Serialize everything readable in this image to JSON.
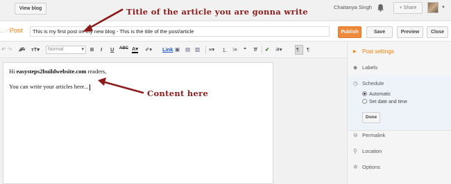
{
  "topbar": {
    "view_blog": "View blog",
    "user_name": "Chaitanya Singh",
    "share": "+ Share"
  },
  "annotations": {
    "title_note": "Title of the article you are gonna write",
    "content_note": "Content here"
  },
  "post": {
    "label": "Post",
    "title_value": "This is my first post on my new blog - This is the title of the post/article",
    "buttons": {
      "publish": "Publish",
      "save": "Save",
      "preview": "Preview",
      "close": "Close"
    }
  },
  "toolbar": {
    "font_size_value": "Normal",
    "link": "Link"
  },
  "editor": {
    "line1_prefix": "Hi ",
    "line1_bold": "easysteps2buildwebsite.com",
    "line1_suffix": " readers,",
    "line2": "You can write your articles here..."
  },
  "sidebar": {
    "post_settings": "Post settings",
    "labels": "Labels",
    "schedule": "Schedule",
    "automatic": "Automatic",
    "set_date": "Set date and time",
    "done": "Done",
    "permalink": "Permalink",
    "location": "Location",
    "options": "Options"
  },
  "colors": {
    "accent": "#f57d00",
    "publish": "#ef8a3c",
    "annotation": "#8b1a1a"
  }
}
